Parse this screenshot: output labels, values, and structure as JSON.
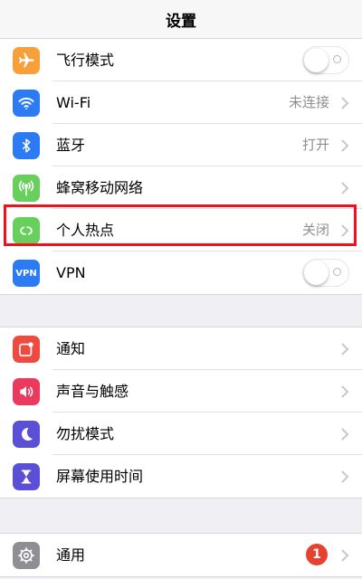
{
  "nav": {
    "title": "设置"
  },
  "group1": [
    {
      "label": "飞行模式",
      "icon": "airplane-icon",
      "icon_color": "#f7a03a",
      "toggle": false
    },
    {
      "label": "Wi-Fi",
      "value": "未连接",
      "icon": "wifi-icon",
      "icon_color": "#2d7bf4"
    },
    {
      "label": "蓝牙",
      "value": "打开",
      "icon": "bluetooth-icon",
      "icon_color": "#2d7bf4"
    },
    {
      "label": "蜂窝移动网络",
      "icon": "cellular-icon",
      "icon_color": "#67cf5c"
    },
    {
      "label": "个人热点",
      "value": "关闭",
      "icon": "hotspot-icon",
      "icon_color": "#67cf5c",
      "highlighted": true
    },
    {
      "label": "VPN",
      "icon": "vpn-icon",
      "icon_color": "#2d7bf4",
      "icon_text": "VPN",
      "toggle": false
    }
  ],
  "group2": [
    {
      "label": "通知",
      "icon": "notification-icon",
      "icon_color": "#ef4a40"
    },
    {
      "label": "声音与触感",
      "icon": "speaker-icon",
      "icon_color": "#ea3a5e"
    },
    {
      "label": "勿扰模式",
      "icon": "moon-icon",
      "icon_color": "#5b4fd6"
    },
    {
      "label": "屏幕使用时间",
      "icon": "hourglass-icon",
      "icon_color": "#5b4fd6"
    }
  ],
  "group3": [
    {
      "label": "通用",
      "icon": "gear-icon",
      "icon_color": "#8e8e93",
      "badge": "1"
    }
  ],
  "colors": {
    "highlight": "#f2101c",
    "badge": "#e5432f"
  }
}
